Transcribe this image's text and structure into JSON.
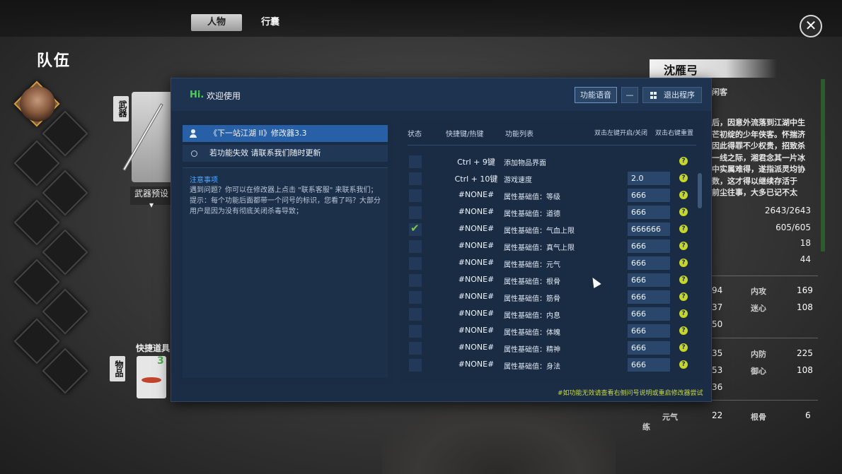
{
  "game": {
    "tabs": [
      "人物",
      "行囊"
    ],
    "close_icon": "close-icon",
    "team_title": "队伍",
    "weapon_label": "武器",
    "weapon_preset": "武器预设",
    "item_label": "物品",
    "quick_items_label": "快捷道具",
    "quick_item_count": "3",
    "character": {
      "name": "沈雁弓",
      "title": "闲客",
      "bio": [
        "后，因意外流落到江湖中生",
        "芒初绽的少年侠客。怀揣济",
        "因此得罪不少权贵，招致杀",
        "一线之际，湘君念其一片冰",
        "中实属难得，遂指派灵均协",
        "数，这才得以继续存活于",
        "前尘往事，大多已记不太"
      ],
      "stats_top": [
        "2643/2643",
        "605/605",
        "18",
        "44"
      ],
      "stats_mid": [
        {
          "left": "94",
          "label": "内攻",
          "right": "169"
        },
        {
          "left": "37",
          "label": "迷心",
          "right": "108"
        },
        {
          "left": "50",
          "label": "",
          "right": ""
        }
      ],
      "stats_low": [
        {
          "left": "35",
          "label": "内防",
          "right": "225"
        },
        {
          "left": "53",
          "label": "御心",
          "right": "108"
        },
        {
          "left": "36",
          "label": "",
          "right": ""
        }
      ],
      "stats_bottom": [
        {
          "side": "练",
          "label1": "元气",
          "val1": "22",
          "label2": "根骨",
          "val2": "6"
        }
      ]
    }
  },
  "tool": {
    "hi": "Hi.",
    "welcome": "欢迎使用",
    "btn_sound": "功能语音",
    "btn_min": "—",
    "btn_exit": "退出程序",
    "title_line": "《下一站江湖 II》修改器3.3",
    "update_line": "若功能失效 请联系我们随时更新",
    "notice_title": "注意事项",
    "notice_text": "遇到问题？你可以在修改器上点击 \"联系客服\" 来联系我们；提示：每个功能后面都带一个问号的标识，您看了吗？大部分用户是因为没有彻底关闭杀毒导致；",
    "headers": {
      "status": "状态",
      "hotkey": "快捷键/热键",
      "func": "功能列表",
      "left_hint": "双击左键开启/关闭",
      "right_hint": "双击右键重置"
    },
    "rows": [
      {
        "checked": false,
        "hotkey": "Ctrl + 9键",
        "func": "添加物品界面",
        "value": ""
      },
      {
        "checked": false,
        "hotkey": "Ctrl + 10键",
        "func": "游戏速度",
        "value": "2.0"
      },
      {
        "checked": false,
        "hotkey": "#NONE#",
        "func": "属性基础值：等级",
        "value": "666"
      },
      {
        "checked": false,
        "hotkey": "#NONE#",
        "func": "属性基础值：道德",
        "value": "666"
      },
      {
        "checked": true,
        "hotkey": "#NONE#",
        "func": "属性基础值：气血上限",
        "value": "666666"
      },
      {
        "checked": false,
        "hotkey": "#NONE#",
        "func": "属性基础值：真气上限",
        "value": "666"
      },
      {
        "checked": false,
        "hotkey": "#NONE#",
        "func": "属性基础值：元气",
        "value": "666"
      },
      {
        "checked": false,
        "hotkey": "#NONE#",
        "func": "属性基础值：根骨",
        "value": "666"
      },
      {
        "checked": false,
        "hotkey": "#NONE#",
        "func": "属性基础值：筋骨",
        "value": "666"
      },
      {
        "checked": false,
        "hotkey": "#NONE#",
        "func": "属性基础值：内息",
        "value": "666"
      },
      {
        "checked": false,
        "hotkey": "#NONE#",
        "func": "属性基础值：体魄",
        "value": "666"
      },
      {
        "checked": false,
        "hotkey": "#NONE#",
        "func": "属性基础值：精神",
        "value": "666"
      },
      {
        "checked": false,
        "hotkey": "#NONE#",
        "func": "属性基础值：身法",
        "value": "666"
      }
    ],
    "help_glyph": "?",
    "footer_hint": "#如功能无效请查看右侧问号说明或重启修改器尝试",
    "colors": {
      "accent": "#2860a8",
      "hi": "#49d24e",
      "help": "#c7d62a",
      "check": "#7ac943"
    }
  }
}
